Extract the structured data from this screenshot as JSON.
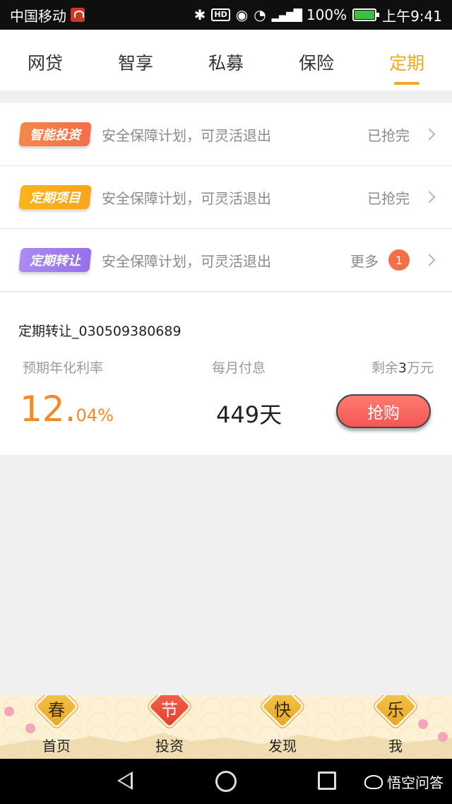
{
  "status_bar": {
    "carrier": "中国移动",
    "hd": "HD",
    "network": "4G",
    "battery": "100%",
    "time": "上午9:41"
  },
  "tabs": [
    {
      "label": "网贷",
      "active": false
    },
    {
      "label": "智享",
      "active": false
    },
    {
      "label": "私募",
      "active": false
    },
    {
      "label": "保险",
      "active": false
    },
    {
      "label": "定期",
      "active": true
    }
  ],
  "list": [
    {
      "tag": "智能投资",
      "desc": "安全保障计划，可灵活退出",
      "status": "已抢完"
    },
    {
      "tag": "定期项目",
      "desc": "安全保障计划，可灵活退出",
      "status": "已抢完"
    },
    {
      "tag": "定期转让",
      "desc": "安全保障计划，可灵活退出",
      "status": "更多",
      "badge": "1"
    }
  ],
  "product": {
    "name": "定期转让_030509380689",
    "rate_label": "预期年化利率",
    "pay_label": "每月付息",
    "remain_prefix": "剩余",
    "remain_value": "3",
    "remain_suffix": "万元",
    "rate_int": "12.",
    "rate_dec": "04%",
    "term": "449天",
    "buy_label": "抢购"
  },
  "bottom_nav": [
    {
      "glyph": "春",
      "label": "首页"
    },
    {
      "glyph": "节",
      "label": "投资",
      "active": true
    },
    {
      "glyph": "快",
      "label": "发现"
    },
    {
      "glyph": "乐",
      "label": "我"
    }
  ],
  "watermark": "悟空问答",
  "colors": {
    "accent": "#f5a623",
    "rate": "#f38a2a",
    "buy": "#f45757"
  }
}
